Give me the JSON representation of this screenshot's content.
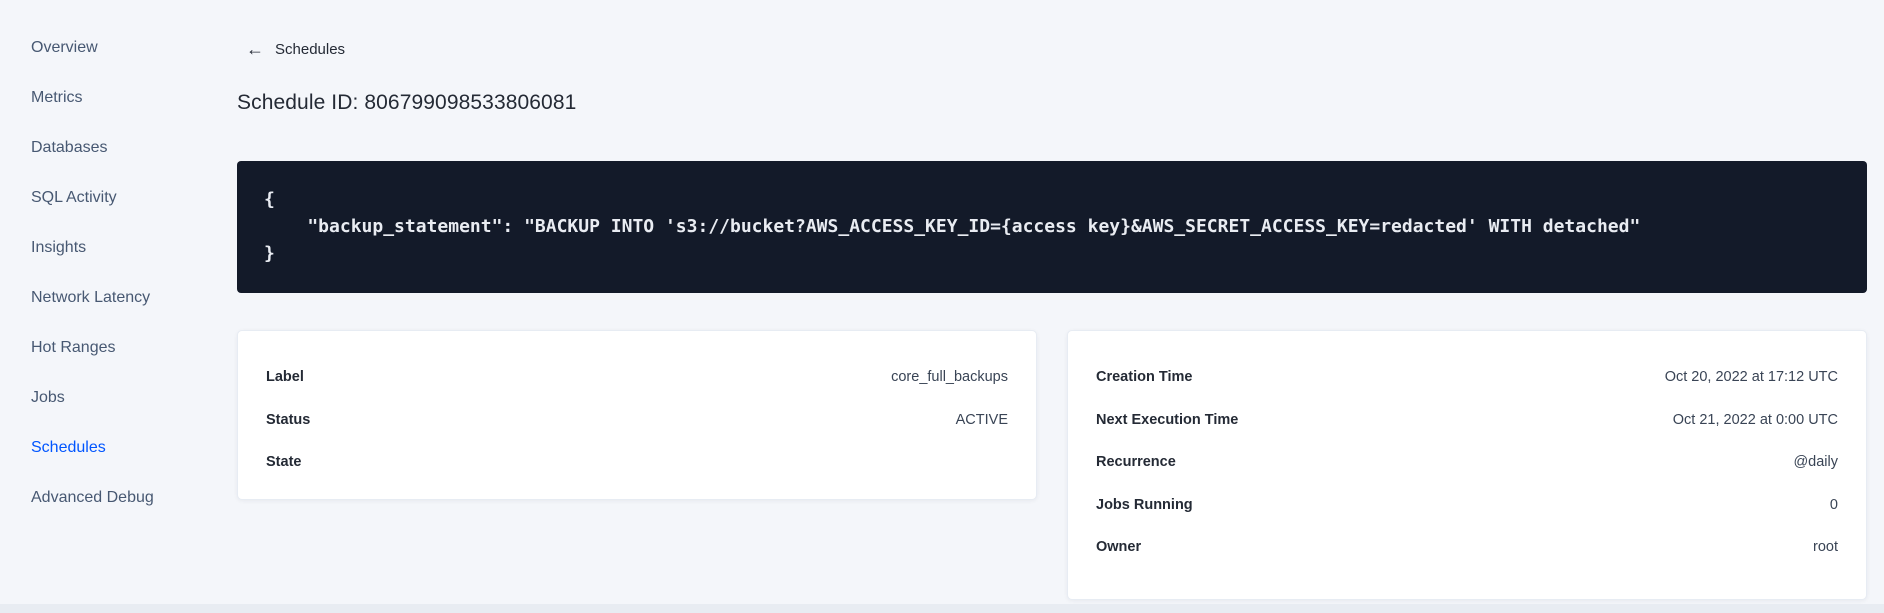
{
  "colors": {
    "accent": "#0055ff",
    "page_bg": "#f4f6fa",
    "code_bg": "#131a29",
    "code_text": "#e9ecf2",
    "text_primary": "#242a35",
    "text_secondary": "#475872",
    "card_bg": "#ffffff",
    "card_border": "#e7ecf3"
  },
  "sidebar": {
    "items": [
      {
        "label": "Overview",
        "active": false
      },
      {
        "label": "Metrics",
        "active": false
      },
      {
        "label": "Databases",
        "active": false
      },
      {
        "label": "SQL Activity",
        "active": false
      },
      {
        "label": "Insights",
        "active": false
      },
      {
        "label": "Network Latency",
        "active": false
      },
      {
        "label": "Hot Ranges",
        "active": false
      },
      {
        "label": "Jobs",
        "active": false
      },
      {
        "label": "Schedules",
        "active": true
      },
      {
        "label": "Advanced Debug",
        "active": false
      }
    ]
  },
  "header": {
    "back_icon": "arrow-left-icon",
    "back_arrow_glyph": "←",
    "back_label": "Schedules",
    "title": "Schedule ID: 806799098533806081"
  },
  "code_block": {
    "lines": [
      "{",
      "    \"backup_statement\": \"BACKUP INTO 's3://bucket?AWS_ACCESS_KEY_ID={access key}&AWS_SECRET_ACCESS_KEY=redacted' WITH detached\"",
      "}"
    ]
  },
  "details_left": {
    "rows": [
      {
        "label": "Label",
        "value": "core_full_backups"
      },
      {
        "label": "Status",
        "value": "ACTIVE"
      },
      {
        "label": "State",
        "value": ""
      }
    ]
  },
  "details_right": {
    "rows": [
      {
        "label": "Creation Time",
        "value": "Oct 20, 2022 at 17:12 UTC"
      },
      {
        "label": "Next Execution Time",
        "value": "Oct 21, 2022 at 0:00 UTC"
      },
      {
        "label": "Recurrence",
        "value": "@daily"
      },
      {
        "label": "Jobs Running",
        "value": "0"
      },
      {
        "label": "Owner",
        "value": "root"
      }
    ]
  }
}
